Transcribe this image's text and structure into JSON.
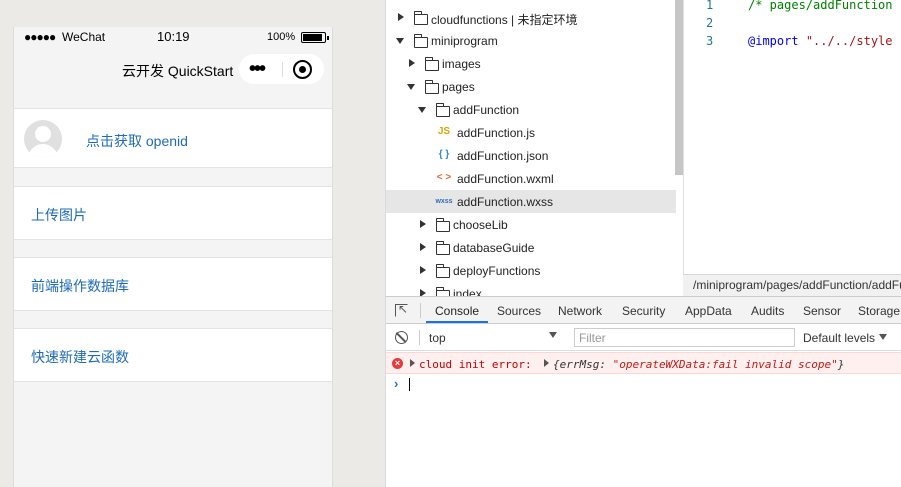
{
  "simulator": {
    "statusbar": {
      "signal": "●●●●●",
      "carrier": "WeChat",
      "time": "10:19",
      "battery_pct": "100%"
    },
    "navbar": {
      "title": "云开发 QuickStart",
      "more_glyph": "•••"
    },
    "cards": {
      "openid": "点击获取 openid",
      "upload": "上传图片",
      "database": "前端操作数据库",
      "cloud_function": "快速新建云函数"
    }
  },
  "file_tree": {
    "items": [
      {
        "label": "cloudfunctions | 未指定环境",
        "type": "folder",
        "expanded": false,
        "depth": 0
      },
      {
        "label": "miniprogram",
        "type": "folder",
        "expanded": true,
        "depth": 0
      },
      {
        "label": "images",
        "type": "folder",
        "expanded": false,
        "depth": 1
      },
      {
        "label": "pages",
        "type": "folder",
        "expanded": true,
        "depth": 1
      },
      {
        "label": "addFunction",
        "type": "folder",
        "expanded": true,
        "depth": 2
      },
      {
        "label": "addFunction.js",
        "type": "js",
        "icon_text": "JS",
        "depth": 3
      },
      {
        "label": "addFunction.json",
        "type": "json",
        "icon_text": "{ }",
        "depth": 3
      },
      {
        "label": "addFunction.wxml",
        "type": "wxml",
        "icon_text": "< >",
        "depth": 3
      },
      {
        "label": "addFunction.wxss",
        "type": "wxss",
        "icon_text": "wxss",
        "depth": 3,
        "selected": true
      },
      {
        "label": "chooseLib",
        "type": "folder",
        "expanded": false,
        "depth": 2
      },
      {
        "label": "databaseGuide",
        "type": "folder",
        "expanded": false,
        "depth": 2
      },
      {
        "label": "deployFunctions",
        "type": "folder",
        "expanded": false,
        "depth": 2
      },
      {
        "label": "index",
        "type": "folder",
        "expanded": false,
        "depth": 2
      }
    ]
  },
  "editor": {
    "lines": [
      {
        "num": "1",
        "comment": "/* pages/addFunction"
      },
      {
        "num": "2"
      },
      {
        "num": "3",
        "keyword": "@import",
        "string": "\"../../style"
      }
    ],
    "path": "/miniprogram/pages/addFunction/addFunction.wxss"
  },
  "devtools": {
    "tabs": [
      "Console",
      "Sources",
      "Network",
      "Security",
      "AppData",
      "Audits",
      "Sensor",
      "Storage"
    ],
    "active_tab": "Console",
    "context": "top",
    "filter_placeholder": "Filter",
    "levels": "Default levels",
    "error": {
      "text": "cloud init error:",
      "object_open": "{errMsg: ",
      "value": "\"operateWXData:fail invalid scope\"",
      "object_close": "}"
    },
    "prompt": "›"
  },
  "colors": {
    "link": "#1e6bb8",
    "error": "#c80000",
    "accent": "#1a73e8"
  }
}
